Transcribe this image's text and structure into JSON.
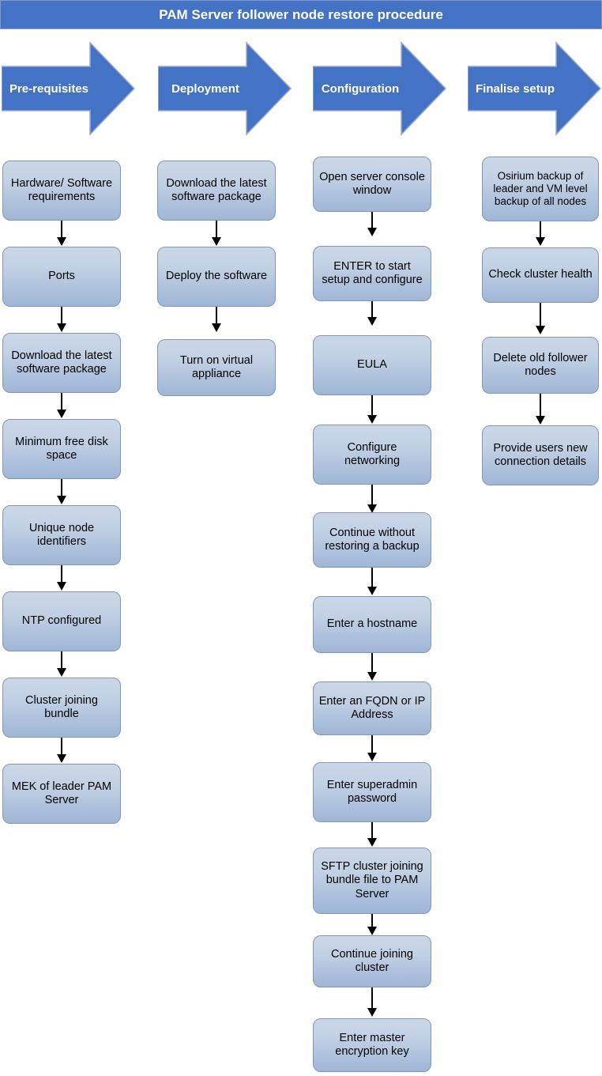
{
  "title": {
    "text": "PAM Server follower node restore procedure",
    "background": "#4472C4",
    "color": "#FFFFFF"
  },
  "phases": [
    {
      "label": "Pre-requisites",
      "color": "#4472C4"
    },
    {
      "label": "Deployment",
      "color": "#4472C4"
    },
    {
      "label": "Configuration",
      "color": "#4472C4"
    },
    {
      "label": "Finalise setup",
      "color": "#4472C4"
    }
  ],
  "columns": [
    {
      "name": "pre-requisites",
      "steps": [
        "Hardware/ Software requirements",
        "Ports",
        "Download the latest software package",
        "Minimum free disk space",
        "Unique node identifiers",
        "NTP configured",
        "Cluster joining bundle",
        "MEK of leader PAM Server"
      ]
    },
    {
      "name": "deployment",
      "steps": [
        "Download the latest software package",
        "Deploy the software",
        "Turn on virtual appliance"
      ]
    },
    {
      "name": "configuration",
      "steps": [
        "Open server console window",
        "ENTER to start setup and configure",
        "EULA",
        "Configure networking",
        "Continue without restoring a backup",
        "Enter a hostname",
        "Enter an FQDN or IP Address",
        "Enter superadmin password",
        "SFTP cluster joining bundle file to PAM Server",
        "Continue joining cluster",
        "Enter master encryption key"
      ]
    },
    {
      "name": "finalise-setup",
      "steps": [
        "Osirium backup of leader and VM level backup of all nodes",
        "Check cluster health",
        "Delete old follower nodes",
        "Provide users new connection details"
      ]
    }
  ],
  "box_style": {
    "fill_top": "#CAD7E8",
    "fill_bottom": "#9FB6D6",
    "border": "#8497B0",
    "text_color": "#000000"
  },
  "connector_style": {
    "color": "#000000",
    "arrowhead": "filled-triangle"
  }
}
